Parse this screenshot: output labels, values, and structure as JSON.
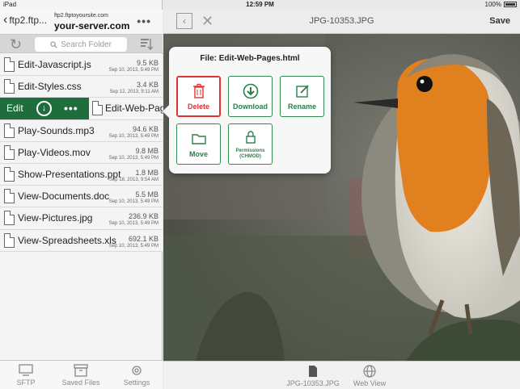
{
  "statusbar": {
    "device": "iPad",
    "time": "12:59 PM",
    "battery": "100%"
  },
  "left": {
    "back_label": "ftp2.ftp...",
    "server_small": "ftp2.ftptoyoursite.com",
    "server_big": "your-server.com",
    "search_placeholder": "Search Folder",
    "swipe": {
      "edit": "Edit",
      "file_name": "Edit-Web-Pag"
    },
    "files": [
      {
        "name": "Edit-Javascript.js",
        "size": "9.5 KB",
        "date": "Sep 10, 2013, 5:49 PM"
      },
      {
        "name": "Edit-Styles.css",
        "size": "3.4 KB",
        "date": "Sep 12, 2013, 9:11 AM"
      },
      {
        "name": "Play-Sounds.mp3",
        "size": "94.6 KB",
        "date": "Sep 10, 2013, 5:49 PM"
      },
      {
        "name": "Play-Videos.mov",
        "size": "9.8 MB",
        "date": "Sep 10, 2013, 5:49 PM"
      },
      {
        "name": "Show-Presentations.ppt",
        "size": "1.8 MB",
        "date": "Sep 18, 2013, 9:54 AM"
      },
      {
        "name": "View-Documents.doc",
        "size": "5.5 MB",
        "date": "Sep 10, 2013, 5:49 PM"
      },
      {
        "name": "View-Pictures.jpg",
        "size": "236.9 KB",
        "date": "Sep 10, 2013, 5:49 PM"
      },
      {
        "name": "View-Spreadsheets.xls",
        "size": "692.1 KB",
        "date": "Sep 10, 2013, 5:49 PM"
      }
    ],
    "tabs": [
      "SFTP",
      "Saved Files",
      "Settings"
    ]
  },
  "right": {
    "title": "JPG-10353.JPG",
    "save": "Save",
    "tabs": [
      "JPG-10353.JPG",
      "Web View"
    ]
  },
  "popup": {
    "title": "File: Edit-Web-Pages.html",
    "delete": "Delete",
    "download": "Download",
    "rename": "Rename",
    "move": "Move",
    "permissions_line1": "Permissions",
    "permissions_line2": "(CHMOD)"
  },
  "colors": {
    "accent_green": "#2a7f47",
    "delete_red": "#dd3333",
    "swipe_green": "#1f6d3d"
  }
}
